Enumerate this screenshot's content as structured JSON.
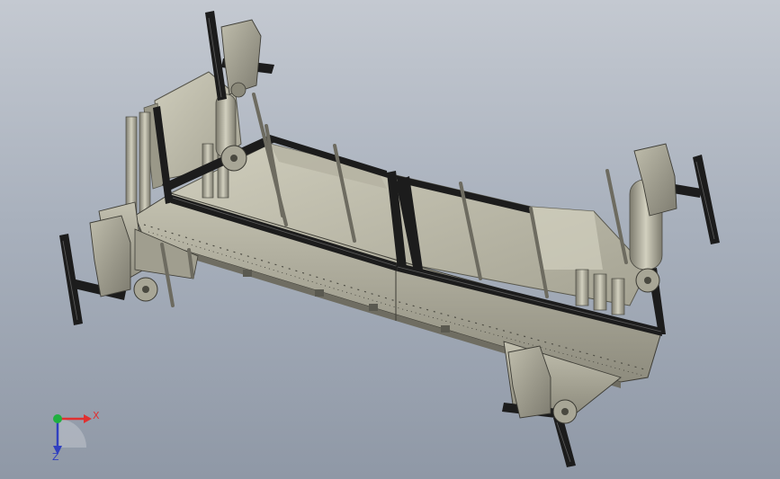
{
  "viewport": {
    "background_top": "#c4c9d1",
    "background_bottom": "#8f98a6"
  },
  "model": {
    "frame_color": "#1c1c1c",
    "body_color": "#a6a494",
    "belt_color": "#bcbaa8",
    "motor_color": "#99978a"
  },
  "triad": {
    "x_label": "X",
    "z_label": "Z",
    "x_color": "#e03030",
    "y_color": "#20b040",
    "z_color": "#3040c0"
  }
}
